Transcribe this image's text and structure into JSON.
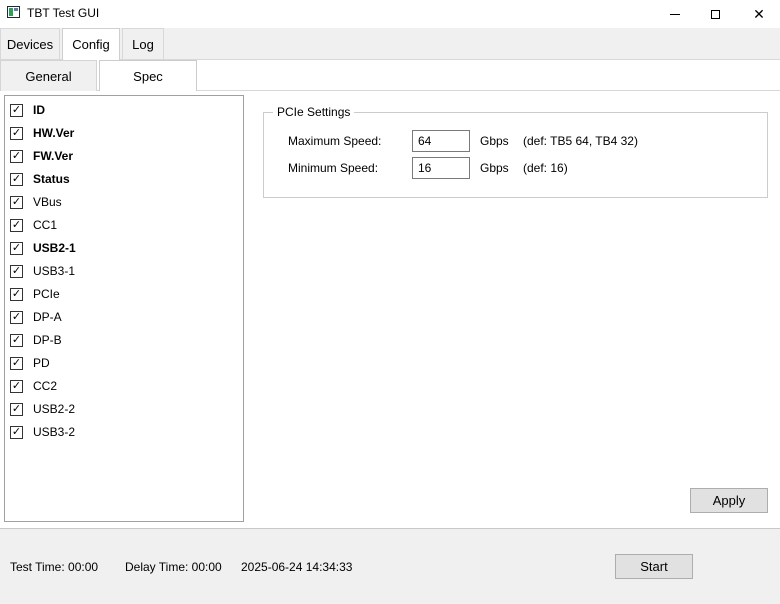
{
  "window": {
    "title": "TBT Test GUI",
    "controls": [
      "minimize-icon",
      "maximize-icon",
      "close-icon"
    ],
    "minimize_glyph": "",
    "close_glyph": "✕"
  },
  "tabs": [
    {
      "label": "Devices",
      "active": false
    },
    {
      "label": "Config",
      "active": true
    },
    {
      "label": "Log",
      "active": false
    }
  ],
  "subtabs": [
    {
      "label": "General",
      "active": false
    },
    {
      "label": "Spec",
      "active": true
    }
  ],
  "check_glyph": "✓",
  "columns": [
    {
      "label": "ID",
      "checked": true,
      "bold": true
    },
    {
      "label": "HW.Ver",
      "checked": true,
      "bold": true
    },
    {
      "label": "FW.Ver",
      "checked": true,
      "bold": true
    },
    {
      "label": "Status",
      "checked": true,
      "bold": true
    },
    {
      "label": "VBus",
      "checked": true,
      "bold": false
    },
    {
      "label": "CC1",
      "checked": true,
      "bold": false
    },
    {
      "label": "USB2-1",
      "checked": true,
      "bold": true
    },
    {
      "label": "USB3-1",
      "checked": true,
      "bold": false
    },
    {
      "label": "PCIe",
      "checked": true,
      "bold": false
    },
    {
      "label": "DP-A",
      "checked": true,
      "bold": false
    },
    {
      "label": "DP-B",
      "checked": true,
      "bold": false
    },
    {
      "label": "PD",
      "checked": true,
      "bold": false
    },
    {
      "label": "CC2",
      "checked": true,
      "bold": false
    },
    {
      "label": "USB2-2",
      "checked": true,
      "bold": false
    },
    {
      "label": "USB3-2",
      "checked": true,
      "bold": false
    }
  ],
  "pcie": {
    "title": "PCIe Settings",
    "max_speed": {
      "label": "Maximum Speed:",
      "value": "64",
      "unit": "Gbps",
      "note": "(def: TB5 64, TB4 32)"
    },
    "min_speed": {
      "label": "Minimum Speed:",
      "value": "16",
      "unit": "Gbps",
      "note": "(def: 16)"
    }
  },
  "apply_label": "Apply",
  "status": {
    "test_time": "Test Time: 00:00",
    "delay_time": "Delay Time: 00:00",
    "datetime": "2025-06-24 14:34:33",
    "start_label": "Start"
  }
}
